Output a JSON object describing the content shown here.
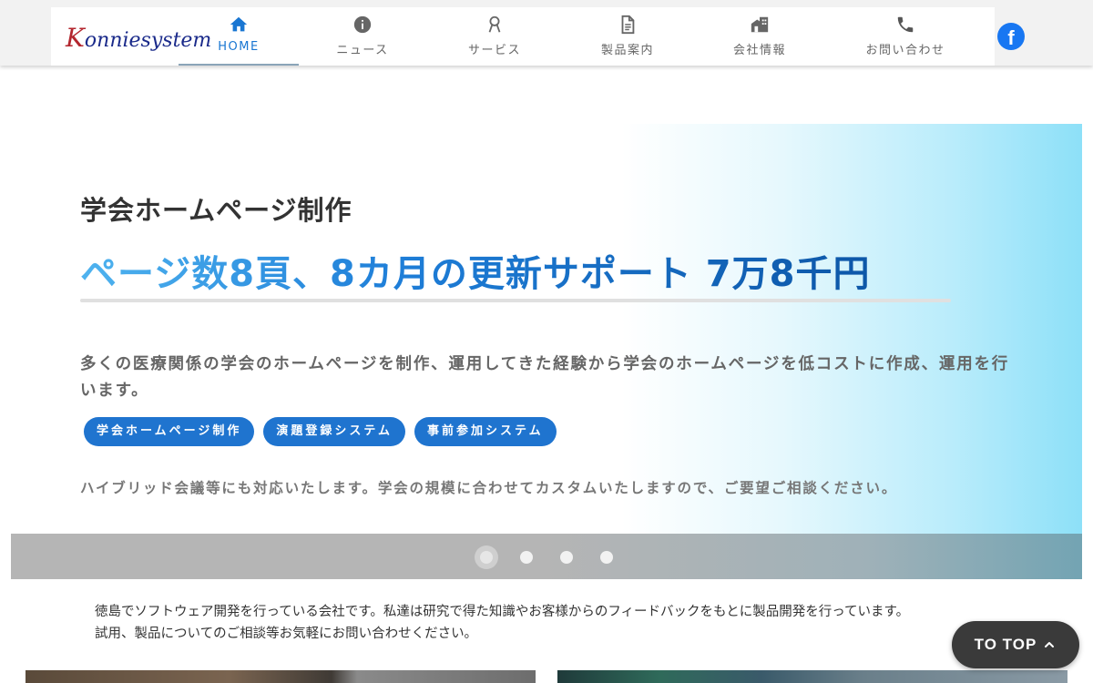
{
  "header": {
    "logo": "Konniesystem",
    "nav": [
      {
        "label": "HOME",
        "icon": "home-icon",
        "active": true
      },
      {
        "label": "ニュース",
        "icon": "info-icon",
        "active": false
      },
      {
        "label": "サービス",
        "icon": "award-icon",
        "active": false
      },
      {
        "label": "製品案内",
        "icon": "document-icon",
        "active": false
      },
      {
        "label": "会社情報",
        "icon": "building-icon",
        "active": false
      },
      {
        "label": "お問い合わせ",
        "icon": "phone-icon",
        "active": false
      }
    ],
    "facebook_icon": "facebook-icon"
  },
  "hero": {
    "title": "学会ホームページ制作",
    "headline": "ページ数8頁、8カ月の更新サポート 7万8千円",
    "description": "多くの医療関係の学会のホームページを制作、運用してきた経験から学会のホームページを低コストに作成、運用を行います。",
    "chips": [
      "学会ホームページ制作",
      "演題登録システム",
      "事前参加システム"
    ],
    "note": "ハイブリッド会議等にも対応いたします。学会の規模に合わせてカスタムいたしますので、ご要望ご相談ください。",
    "slides": 4,
    "active_slide": 1
  },
  "intro": {
    "line1": "徳島でソフトウェア開発を行っている会社です。私達は研究で得た知識やお客様からのフィードバックをもとに製品開発を行っています。",
    "line2": "試用、製品についてのご相談等お気軽にお問い合わせください。"
  },
  "to_top": {
    "label": "TO TOP"
  },
  "colors": {
    "accent": "#1976d2",
    "chip": "#1f74cf",
    "facebook": "#1877f2",
    "to_top_bg": "#3a3a3a"
  }
}
